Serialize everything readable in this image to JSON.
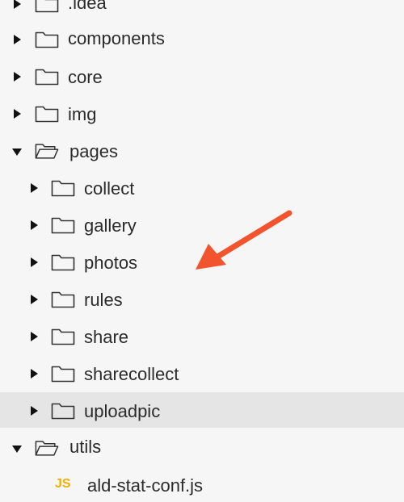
{
  "tree": {
    "idea": ".idea",
    "components": "components",
    "core": "core",
    "img": "img",
    "pages": "pages",
    "collect": "collect",
    "gallery": "gallery",
    "photos": "photos",
    "rules": "rules",
    "share": "share",
    "sharecollect": "sharecollect",
    "uploadpic": "uploadpic",
    "utils": "utils",
    "ald_file_badge": "JS",
    "ald_file": "ald-stat-conf.js"
  },
  "colors": {
    "background": "#f6f6f6",
    "selected_row": "#e5e5e5",
    "annotation_arrow": "#f2542d",
    "js_badge": "#f0b000"
  },
  "icons": {
    "folder_closed": "folder-icon",
    "folder_open": "folder-open-icon",
    "caret_collapsed": "caret-right-icon",
    "caret_expanded": "caret-down-icon",
    "annotation": "red-pointer-arrow"
  }
}
